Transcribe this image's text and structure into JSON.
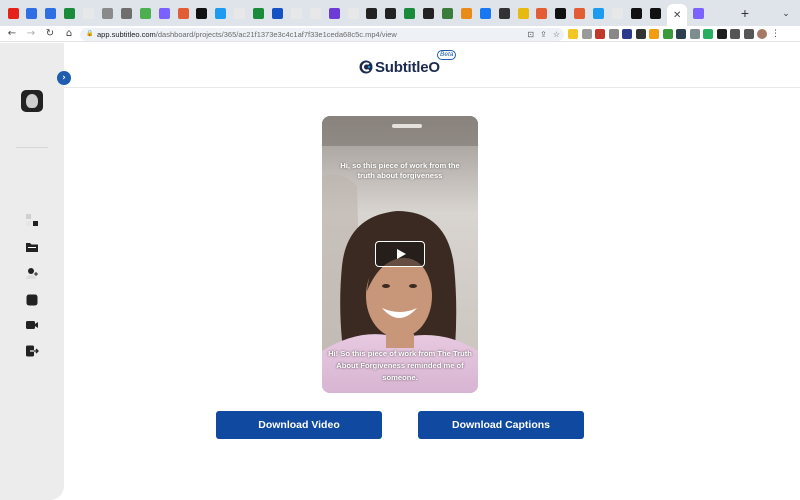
{
  "browser": {
    "tab_count": 37,
    "active_tab_close": "✕",
    "new_tab": "+",
    "tab_menu": "⌄",
    "url_host": "app.subtitleo.com",
    "url_path": "/dashboard/projects/365/ac21f1373e3c4c1af7f33e1ceda68c5c.mp4/view",
    "tab_colors": [
      "#e62117",
      "#2f6fe3",
      "#2f6fe3",
      "#1a8a3b",
      "#e8e8e8",
      "#8a8a8a",
      "#6e6e6e",
      "#4caf50",
      "#7b61ff",
      "#e25d33",
      "#111111",
      "#1d9bf0",
      "#e8e8e8",
      "#1a8a3b",
      "#1652c4",
      "#e8e8e8",
      "#e8e8e8",
      "#6c3bd6",
      "#e8e8e8",
      "#222222",
      "#222222",
      "#1a8a3b",
      "#222222",
      "#3b7c3b",
      "#e88b1b",
      "#1877f2",
      "#333333",
      "#e8b90e",
      "#e25d33",
      "#111111",
      "#e25d33",
      "#1d9bf0",
      "#e8e8e8",
      "#111111",
      "#111111",
      "#2a5db0",
      "#7b61ff"
    ]
  },
  "brand": {
    "name": "SubtitleO",
    "badge": "Beta",
    "accent": "#0f4aa0"
  },
  "video": {
    "caption_top": "Hi, so this piece of work from the truth about forgiveness",
    "caption_bottom": "Hi! So this piece of work from The Truth About Forgiveness reminded me of someone."
  },
  "actions": {
    "download_video": "Download Video",
    "download_captions": "Download Captions"
  },
  "sidebar": {
    "items": [
      "dashboard-icon",
      "folder-icon",
      "add-user-icon",
      "stop-icon",
      "video-icon",
      "logout-icon"
    ]
  }
}
